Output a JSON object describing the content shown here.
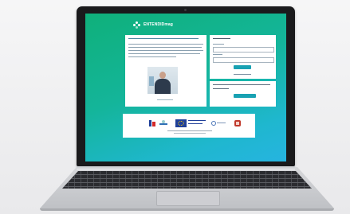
{
  "screen": {
    "header": {
      "logo_name": "ENTENDIDmag",
      "tagline": "",
      "accent": "#19a2b3"
    },
    "intro": {
      "title": "",
      "video_label": "presenter"
    },
    "login": {
      "heading": "",
      "user_label": "",
      "password_label": "",
      "submit_label": "",
      "forgot_label": ""
    },
    "register": {
      "text": "",
      "button_label": ""
    },
    "logos": {
      "eu_text": ""
    }
  },
  "colors": {
    "screen_gradient_start": "#0fb07a",
    "screen_gradient_end": "#26b4e0",
    "button": "#19a2b3",
    "eu_blue": "#1f3f99"
  }
}
